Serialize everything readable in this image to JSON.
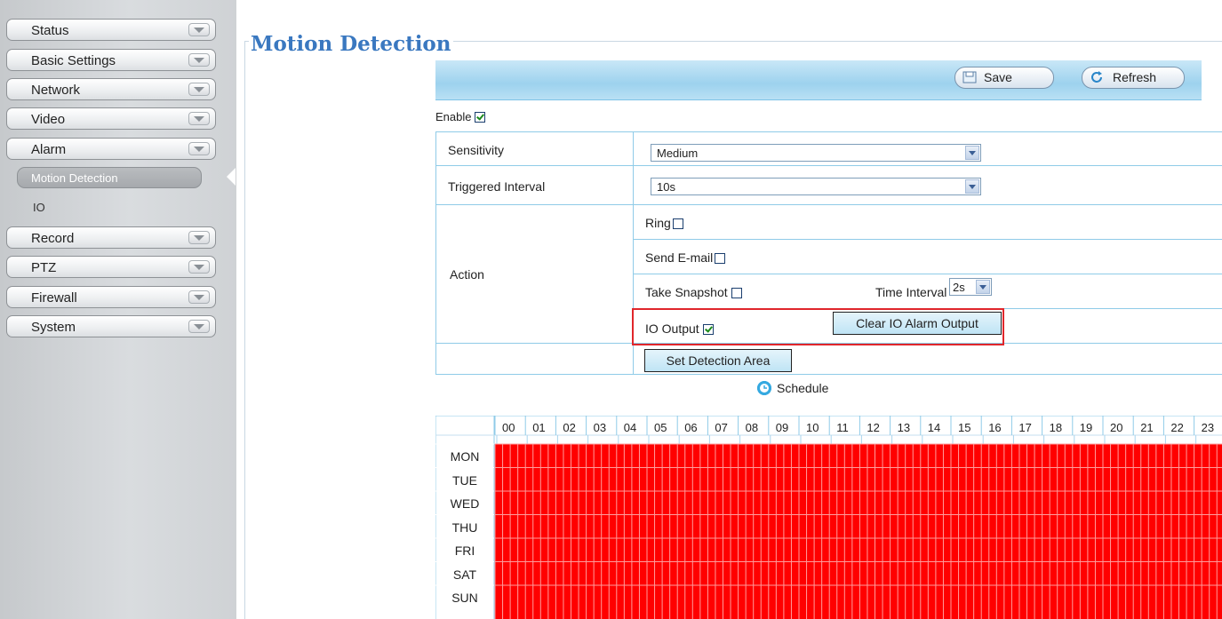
{
  "sidebar": {
    "items": [
      {
        "label": "Status"
      },
      {
        "label": "Basic Settings"
      },
      {
        "label": "Network"
      },
      {
        "label": "Video"
      },
      {
        "label": "Alarm"
      },
      {
        "label": "Record"
      },
      {
        "label": "PTZ"
      },
      {
        "label": "Firewall"
      },
      {
        "label": "System"
      }
    ],
    "alarm_sub": {
      "active": "Motion Detection",
      "other": "IO"
    }
  },
  "main": {
    "title": "Motion Detection",
    "toolbar": {
      "save_label": "Save",
      "refresh_label": "Refresh"
    },
    "enable": {
      "label": "Enable",
      "checked": true
    },
    "sensitivity": {
      "label": "Sensitivity",
      "value": "Medium"
    },
    "triggered_interval": {
      "label": "Triggered Interval",
      "value": "10s"
    },
    "action": {
      "label": "Action",
      "ring": {
        "label": "Ring",
        "checked": false
      },
      "send_email": {
        "label": "Send E-mail",
        "checked": false
      },
      "take_snapshot": {
        "label": "Take Snapshot",
        "checked": false
      },
      "time_interval": {
        "label": "Time Interval",
        "value": "2s"
      },
      "io_output": {
        "label": "IO Output",
        "checked": true
      },
      "clear_io_button": "Clear IO Alarm Output"
    },
    "set_detection_area_button": "Set Detection Area",
    "schedule": {
      "label": "Schedule",
      "hours": [
        "00",
        "01",
        "02",
        "03",
        "04",
        "05",
        "06",
        "07",
        "08",
        "09",
        "10",
        "11",
        "12",
        "13",
        "14",
        "15",
        "16",
        "17",
        "18",
        "19",
        "20",
        "21",
        "22",
        "23"
      ],
      "days": [
        "MON",
        "TUE",
        "WED",
        "THU",
        "FRI",
        "SAT",
        "SUN"
      ],
      "all_selected": true,
      "selected_color": "#ff0000"
    }
  }
}
